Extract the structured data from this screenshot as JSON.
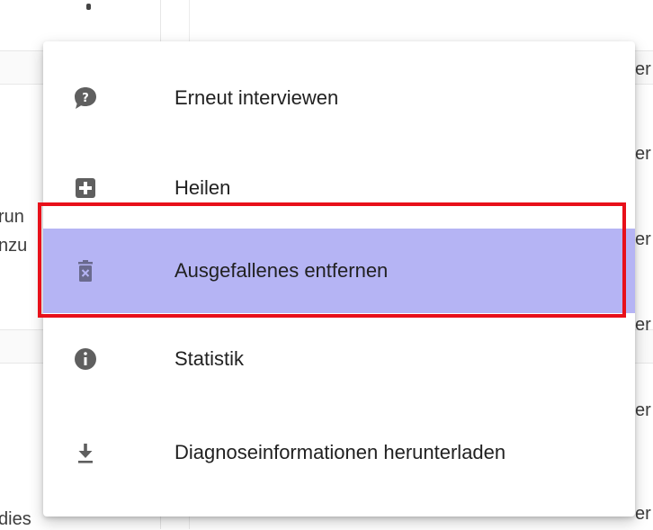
{
  "background": {
    "left_texts": [
      "run",
      "nzu",
      "dies"
    ],
    "right_text": "er"
  },
  "menu": {
    "items": [
      {
        "label": "Erneut interviewen",
        "icon": "chat-question-icon"
      },
      {
        "label": "Heilen",
        "icon": "plus-box-icon"
      },
      {
        "label": "Ausgefallenes entfernen",
        "icon": "delete-box-icon",
        "selected": true
      },
      {
        "label": "Statistik",
        "icon": "info-icon"
      },
      {
        "label": "Diagnoseinformationen herunterladen",
        "icon": "download-icon"
      }
    ]
  },
  "colors": {
    "selected_bg": "#b5b4f4",
    "highlight_border": "#e8101a",
    "icon": "#5f5f5f",
    "selected_icon": "#6a6a8e"
  }
}
